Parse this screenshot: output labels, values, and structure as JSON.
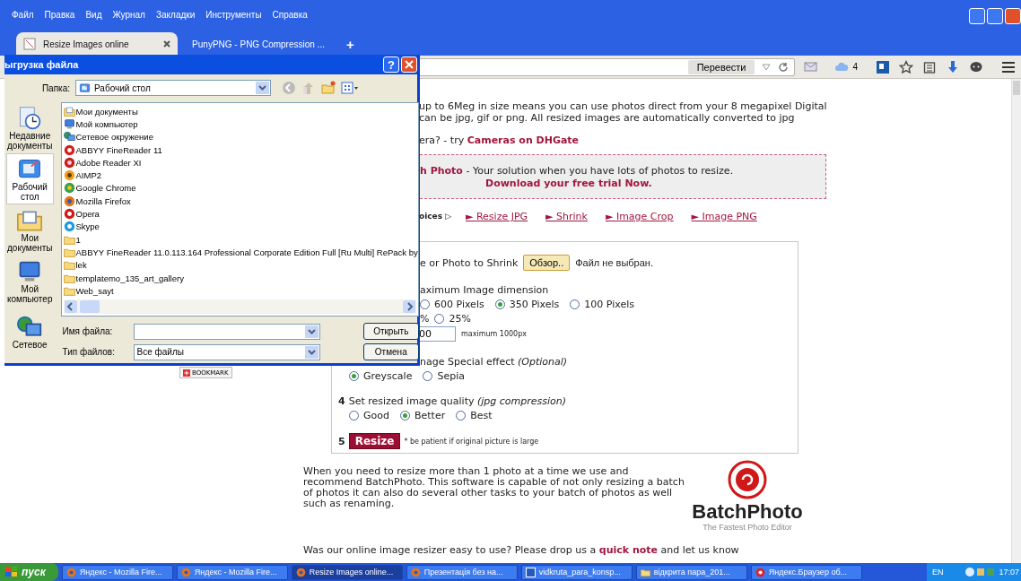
{
  "menu": [
    "Файл",
    "Правка",
    "Вид",
    "Журнал",
    "Закладки",
    "Инструменты",
    "Справка"
  ],
  "tabs": [
    {
      "label": "Resize Images online",
      "kind": "page",
      "selected": true
    },
    {
      "label": "PunyPNG - PNG Compression ...",
      "kind": "badge",
      "selected": false
    }
  ],
  "new_tab": "+",
  "toolbar": {
    "translate_button": "Перевести",
    "cloud_count": "4"
  },
  "dialog": {
    "title": "ыгрузка файла",
    "help": "?",
    "folder_label": "Папка:",
    "folder": "Рабочий стол",
    "places": [
      {
        "label": "Недавние документы",
        "kind": "recent",
        "selected": false
      },
      {
        "label": "Рабочий стол",
        "kind": "desktop",
        "selected": true
      },
      {
        "label": "Мои документы",
        "kind": "documents",
        "selected": false
      },
      {
        "label": "Мой компьютер",
        "kind": "computer",
        "selected": false
      },
      {
        "label": "Сетевое",
        "kind": "network",
        "selected": false
      }
    ],
    "files": [
      {
        "name": "Мои документы",
        "kind": "documents"
      },
      {
        "name": "Мой компьютер",
        "kind": "computer"
      },
      {
        "name": "Сетевое окружение",
        "kind": "network"
      },
      {
        "name": "ABBYY FineReader 11",
        "kind": "abbyy"
      },
      {
        "name": "Adobe Reader XI",
        "kind": "pdf"
      },
      {
        "name": "AIMP2",
        "kind": "aimp"
      },
      {
        "name": "Google Chrome",
        "kind": "chrome"
      },
      {
        "name": "Mozilla Firefox",
        "kind": "firefox"
      },
      {
        "name": "Opera",
        "kind": "opera"
      },
      {
        "name": "Skype",
        "kind": "skype"
      },
      {
        "name": "1",
        "kind": "folder"
      },
      {
        "name": "ABBYY FineReader 11.0.113.164 Professional Corporate Edition Full [Ru Multi] RePack by",
        "kind": "folder"
      },
      {
        "name": "lek",
        "kind": "folder"
      },
      {
        "name": "templatemo_135_art_gallery",
        "kind": "folder"
      },
      {
        "name": "Web_sayt",
        "kind": "folder"
      }
    ],
    "filename_label": "Имя файла:",
    "filetype_label": "Тип файлов:",
    "filetype": "Все файлы",
    "open_button": "Открыть",
    "cancel_button": "Отмена"
  },
  "bookmark_button": "BOOKMARK",
  "page": {
    "intro_lines": [
      "up to 6Meg in size means you can use photos direct from your 8 megapixel Digital",
      "can be jpg, gif or png. All resized images are automatically converted to jpg"
    ],
    "camera_prefix": "era? - try",
    "camera_link": "Cameras on DHGate",
    "promo": {
      "link": "h Photo",
      "text": "- Your solution when you have lots of photos to resize.",
      "download": "Download your free trial Now."
    },
    "choices_label": "oices ▷",
    "links": [
      "► Resize JPG",
      "► Shrink",
      "► Image Crop",
      "► Image PNG"
    ],
    "form": {
      "step1": {
        "label": "e or Photo to Shrink",
        "browse": "Обзор..",
        "status": "Файл не выбран."
      },
      "step2": {
        "label": "aximum Image dimension",
        "sizes": [
          {
            "label": "600 Pixels",
            "selected": false
          },
          {
            "label": "350 Pixels",
            "selected": true
          },
          {
            "label": "100 Pixels",
            "selected": false
          }
        ],
        "percent_fragment": "%",
        "percents": [
          {
            "label": "25%",
            "selected": false
          }
        ],
        "custom_value": "00",
        "custom_hint": "maximum 1000px"
      },
      "step3": {
        "label": "nage Special effect *(Optional)*",
        "effects": [
          {
            "label": "Greyscale",
            "selected": true
          },
          {
            "label": "Sepia",
            "selected": false
          }
        ]
      },
      "step4": {
        "number": "4",
        "label": "Set resized image quality *(jpg compression)*",
        "qualities": [
          {
            "label": "Good",
            "selected": false
          },
          {
            "label": "Better",
            "selected": true
          },
          {
            "label": "Best",
            "selected": false
          }
        ]
      },
      "step5": {
        "number": "5",
        "button": "Resize",
        "note": "* be patient if original picture is large"
      }
    },
    "batch_text": "When you need to resize more than 1 photo at a time we use and recommend BatchPhoto. This software is capable of not only resizing a batch of photos it can also do several other tasks to your batch of photos as well such as renaming.",
    "logo": {
      "name": "BatchPhoto",
      "tagline": "The Fastest Photo Editor"
    },
    "feedback": {
      "prefix": "Was our online image resizer easy to use? Please drop us a",
      "link": "quick note",
      "suffix": "and let us know"
    }
  },
  "taskbar": {
    "start": "пуск",
    "tasks": [
      {
        "label": "Яндекс - Mozilla Fire...",
        "kind": "firefox",
        "selected": false
      },
      {
        "label": "Яндекс - Mozilla Fire...",
        "kind": "firefox",
        "selected": false
      },
      {
        "label": "Resize Images online...",
        "kind": "firefox",
        "selected": true
      },
      {
        "label": "Презентація без на...",
        "kind": "firefox",
        "selected": false
      },
      {
        "label": "vidkruta_para_konsp...",
        "kind": "word",
        "selected": false
      },
      {
        "label": "відкрита пара_201...",
        "kind": "folder",
        "selected": false
      },
      {
        "label": "Яндекс.Браузер об...",
        "kind": "yandex",
        "selected": false
      }
    ],
    "language": "EN",
    "clock": "17:07"
  }
}
